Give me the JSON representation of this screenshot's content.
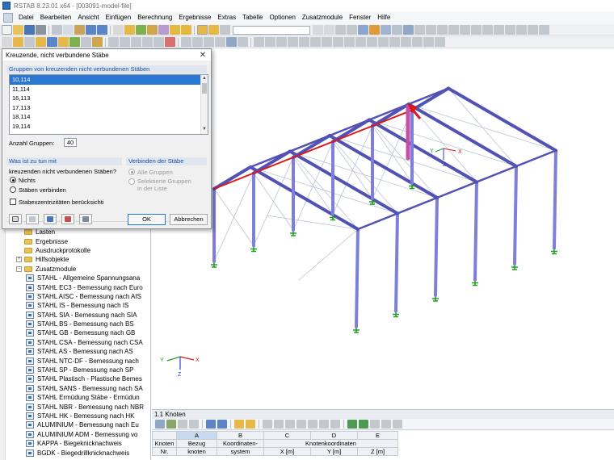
{
  "window": {
    "title": "RSTAB 8.23.01 x64 - [003091-model-file]"
  },
  "menu": [
    "Datei",
    "Bearbeiten",
    "Ansicht",
    "Einfügen",
    "Berechnung",
    "Ergebnisse",
    "Extras",
    "Tabelle",
    "Optionen",
    "Zusatzmodule",
    "Fenster",
    "Hilfe"
  ],
  "dialog": {
    "title": "Kreuzende, nicht verbundene Stäbe",
    "close_icon": "close-icon",
    "groups_header": "Gruppen von kreuzenden nicht verbundenen Stäben",
    "groups": [
      "10,114",
      "11,114",
      "16,113",
      "17,113",
      "18,114",
      "19,114"
    ],
    "selected_group": "10,114",
    "count_label": "Anzahl Gruppen:",
    "count_value": "40",
    "action_header": "Was ist zu tun mit",
    "action_question": "kreuzenden nicht verbundenen Stäben?",
    "action_nothing": "Nichts",
    "action_connect": "Stäben verbinden",
    "connect_header": "Verbinden der Stäbe",
    "connect_all": "Alle Gruppen",
    "connect_selected": "Selektierte Gruppen in der Liste",
    "connect_selected_line1": "Selektierte Gruppen",
    "connect_selected_line2": "in der Liste",
    "eccentricity_label": "Stabexzentrizitäten berücksichti",
    "ok_label": "OK",
    "cancel_label": "Abbrechen"
  },
  "navigator": {
    "items": [
      {
        "label": "Lasten",
        "type": "folder",
        "expandable": false
      },
      {
        "label": "Ergebnisse",
        "type": "folder",
        "expandable": false
      },
      {
        "label": "Ausdruckprotokolle",
        "type": "folder",
        "expandable": false
      },
      {
        "label": "Hilfsobjekte",
        "type": "folder",
        "expandable": true
      },
      {
        "label": "Zusatzmodule",
        "type": "folder",
        "expandable": true,
        "expanded": true
      },
      {
        "label": "STAHL - Allgemeine Spannungsana",
        "type": "module"
      },
      {
        "label": "STAHL EC3 - Bemessung nach Euro",
        "type": "module"
      },
      {
        "label": "STAHL AISC - Bemessung nach AIS",
        "type": "module"
      },
      {
        "label": "STAHL IS - Bemessung nach IS",
        "type": "module"
      },
      {
        "label": "STAHL SIA - Bemessung nach SIA",
        "type": "module"
      },
      {
        "label": "STAHL BS - Bemessung nach BS",
        "type": "module"
      },
      {
        "label": "STAHL GB - Bemessung nach GB",
        "type": "module"
      },
      {
        "label": "STAHL CSA - Bemessung nach CSA",
        "type": "module"
      },
      {
        "label": "STAHL AS - Bemessung nach AS",
        "type": "module"
      },
      {
        "label": "STAHL NTC-DF - Bemessung nach",
        "type": "module"
      },
      {
        "label": "STAHL SP - Bemessung nach SP",
        "type": "module"
      },
      {
        "label": "STAHL Plastisch - Plastische Bemes",
        "type": "module"
      },
      {
        "label": "STAHL SANS - Bemessung nach SA",
        "type": "module"
      },
      {
        "label": "STAHL Ermüdung Stäbe - Ermüdun",
        "type": "module"
      },
      {
        "label": "STAHL NBR - Bemessung nach NBR",
        "type": "module"
      },
      {
        "label": "STAHL HK - Bemessung nach HK",
        "type": "module"
      },
      {
        "label": "ALUMINIUM - Bemessung nach Eu",
        "type": "module"
      },
      {
        "label": "ALUMINIUM ADM - Bemessung vo",
        "type": "module"
      },
      {
        "label": "KAPPA - Biegeknicknachweis",
        "type": "module"
      },
      {
        "label": "BGDK - Biegedrillknicknachweis",
        "type": "module"
      }
    ]
  },
  "bottom_panel": {
    "title": "1.1 Knoten",
    "columns": [
      "A",
      "B",
      "C",
      "D",
      "E"
    ],
    "header_row1": [
      "Knoten",
      "Bezug",
      "Koordinaten-",
      "Knotenkoordinaten",
      "",
      ""
    ],
    "header_row2": [
      "Nr.",
      "knoten",
      "system",
      "X [m]",
      "Y [m]",
      "Z [m]"
    ]
  },
  "axes": {
    "x": "X",
    "y": "Y",
    "z": "Z"
  },
  "colors": {
    "member": "#7f7fd9",
    "member_dark": "#5252b4",
    "highlight": "#e01515",
    "support": "#1fa01f",
    "selection": "#2a78d4"
  }
}
